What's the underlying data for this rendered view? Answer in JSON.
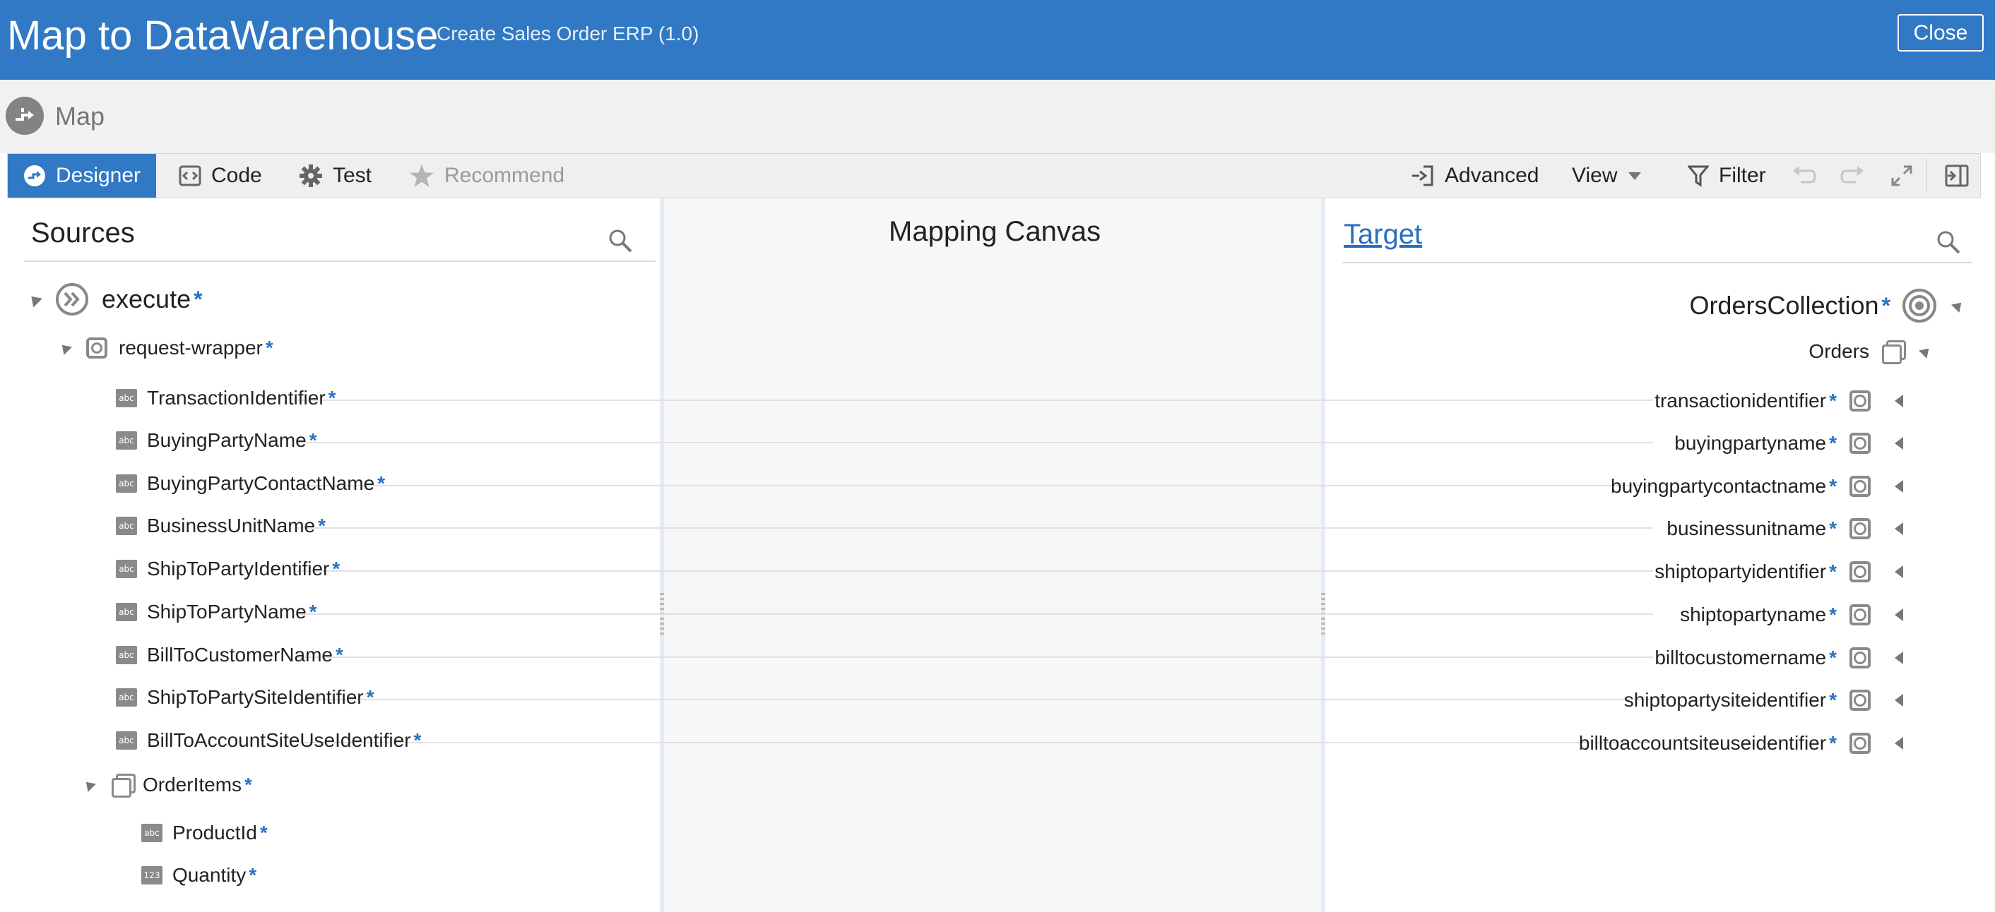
{
  "header": {
    "title": "Map to DataWarehouse",
    "subtitle": "Create Sales Order ERP (1.0)",
    "close_label": "Close"
  },
  "subheader": {
    "label": "Map"
  },
  "toolbar": {
    "designer": "Designer",
    "code": "Code",
    "test": "Test",
    "recommend": "Recommend",
    "advanced": "Advanced",
    "view": "View",
    "filter": "Filter"
  },
  "sources": {
    "title": "Sources",
    "root": {
      "label": "execute"
    },
    "wrapper": {
      "label": "request-wrapper"
    },
    "fields": [
      {
        "label": "TransactionIdentifier"
      },
      {
        "label": "BuyingPartyName"
      },
      {
        "label": "BuyingPartyContactName"
      },
      {
        "label": "BusinessUnitName"
      },
      {
        "label": "ShipToPartyIdentifier"
      },
      {
        "label": "ShipToPartyName"
      },
      {
        "label": "BillToCustomerName"
      },
      {
        "label": "ShipToPartySiteIdentifier"
      },
      {
        "label": "BillToAccountSiteUseIdentifier"
      }
    ],
    "order_items": {
      "label": "OrderItems",
      "fields": [
        {
          "label": "ProductId",
          "type_badge": "abc"
        },
        {
          "label": "Quantity",
          "type_badge": "123"
        }
      ]
    },
    "type_badge": "abc",
    "required_marker": "*"
  },
  "canvas": {
    "title": "Mapping Canvas"
  },
  "target": {
    "title": "Target",
    "root": {
      "label": "OrdersCollection"
    },
    "collection": {
      "label": "Orders"
    },
    "fields": [
      {
        "label": "transactionidentifier"
      },
      {
        "label": "buyingpartyname"
      },
      {
        "label": "buyingpartycontactname"
      },
      {
        "label": "businessunitname"
      },
      {
        "label": "shiptopartyidentifier"
      },
      {
        "label": "shiptopartyname"
      },
      {
        "label": "billtocustomername"
      },
      {
        "label": "shiptopartysiteidentifier"
      },
      {
        "label": "billtoaccountsiteuseidentifier"
      }
    ]
  },
  "colors": {
    "accent": "#3179c4",
    "required": "#2a72c2",
    "header_bg": "#3179c4"
  }
}
